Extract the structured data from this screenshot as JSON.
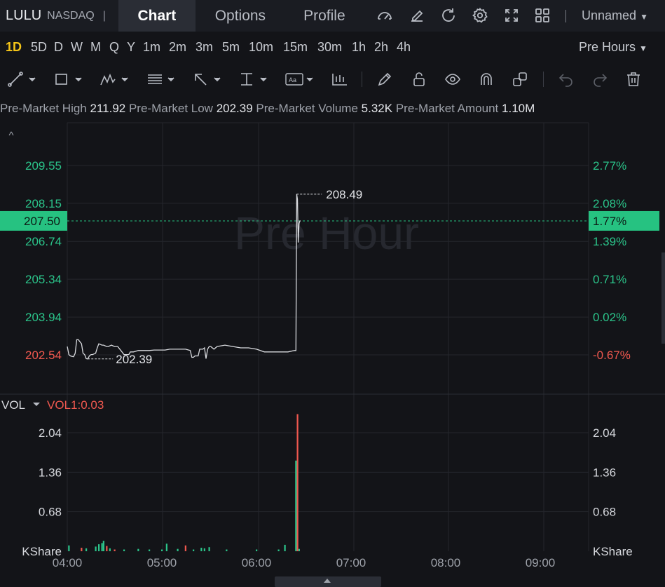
{
  "header": {
    "symbol": "LULU",
    "exchange": "NASDAQ",
    "separator": "|",
    "tabs": [
      {
        "label": "Chart",
        "active": true
      },
      {
        "label": "Options",
        "active": false
      },
      {
        "label": "Profile",
        "active": false
      }
    ],
    "icons": [
      "gauge-icon",
      "edit-icon",
      "refresh-icon",
      "gear-icon",
      "fullscreen-icon",
      "grid-icon"
    ],
    "layout_name": "Unnamed"
  },
  "intervals": {
    "items": [
      "1D",
      "5D",
      "D",
      "W",
      "M",
      "Q",
      "Y",
      "1m",
      "2m",
      "3m",
      "5m",
      "10m",
      "15m",
      "30m",
      "1h",
      "2h",
      "4h"
    ],
    "active": "1D",
    "session": "Pre Hours"
  },
  "toolbar": {
    "tools": [
      "trend-line-icon",
      "rectangle-icon",
      "pattern-icon",
      "fib-icon",
      "arrow-icon",
      "measure-icon",
      "text-icon",
      "indicator-icon",
      "pencil-icon",
      "lock-icon",
      "eye-icon",
      "magnet-icon",
      "layers-icon",
      "undo-icon",
      "redo-icon",
      "trash-icon"
    ]
  },
  "info": {
    "high_label": "Pre-Market High",
    "high": "211.92",
    "low_label": "Pre-Market Low",
    "low": "202.39",
    "volume_label": "Pre-Market Volume",
    "volume": "5.32K",
    "amount_label": "Pre-Market Amount",
    "amount": "1.10M"
  },
  "colors": {
    "up": "#2bc48a",
    "down": "#f0584f",
    "current_bg": "#26c281",
    "line": "#d8dade"
  },
  "chart_data": {
    "type": "line",
    "watermark": "Pre Hour",
    "collapse_glyph": "^",
    "price_axis_left": [
      "209.55",
      "208.15",
      "206.74",
      "205.34",
      "203.94",
      "202.54"
    ],
    "price_axis_right": [
      "2.77%",
      "2.08%",
      "1.39%",
      "0.71%",
      "0.02%",
      "-0.67%"
    ],
    "price_ticks": [
      209.55,
      208.15,
      206.74,
      205.34,
      203.94,
      202.54
    ],
    "current_price": "207.50",
    "current_pct": "1.77%",
    "current_value": 207.5,
    "max_label": "208.49",
    "max_value": 208.49,
    "min_label": "202.39",
    "min_value": 202.39,
    "x_ticks": [
      "04:00",
      "05:00",
      "06:00",
      "07:00",
      "08:00",
      "09:00"
    ],
    "x_values": [
      240,
      300,
      360,
      420,
      480,
      540
    ],
    "series": [
      {
        "x": [
          240,
          241,
          242,
          243,
          244,
          245,
          246,
          247,
          249,
          250,
          251,
          252,
          253,
          254,
          255,
          256,
          258,
          259,
          260,
          262,
          263,
          265,
          266,
          268,
          270,
          272,
          274,
          276,
          278,
          279,
          280,
          282,
          285,
          288,
          290,
          292,
          295,
          296,
          297,
          298,
          300,
          302,
          305,
          310,
          315,
          318,
          319,
          320,
          321,
          322,
          323,
          324,
          326,
          327,
          328,
          329,
          330,
          331,
          333,
          335,
          340,
          345,
          350,
          355,
          360,
          365,
          370,
          375,
          380,
          384,
          385,
          385.5,
          386,
          386.5,
          387,
          387.5,
          388
        ],
        "y": [
          202.85,
          202.55,
          202.5,
          202.48,
          202.47,
          202.6,
          203.1,
          203.1,
          202.95,
          202.6,
          202.55,
          202.4,
          202.39,
          202.5,
          202.55,
          202.55,
          202.6,
          202.8,
          202.95,
          202.9,
          202.9,
          202.85,
          202.85,
          202.9,
          202.85,
          202.85,
          202.7,
          202.55,
          202.55,
          202.55,
          202.65,
          202.65,
          202.7,
          202.7,
          202.7,
          202.7,
          202.72,
          202.72,
          202.72,
          202.72,
          202.72,
          202.72,
          202.75,
          202.75,
          202.75,
          202.7,
          202.45,
          202.45,
          202.5,
          202.5,
          202.5,
          202.75,
          202.75,
          202.8,
          202.4,
          202.75,
          202.85,
          202.85,
          202.75,
          202.85,
          202.9,
          202.85,
          202.8,
          202.8,
          202.75,
          202.65,
          202.65,
          202.65,
          202.65,
          202.7,
          202.7,
          208.49,
          208.3,
          206.7,
          207.4,
          207.5,
          207.5
        ]
      }
    ],
    "volume": {
      "label": "VOL",
      "indicator_label": "VOL1:0.03",
      "unit": "KShare",
      "axis_labels": [
        "2.04",
        "1.36",
        "0.68"
      ],
      "axis_values": [
        2.04,
        1.36,
        0.68
      ],
      "bars": [
        {
          "x": 241,
          "v": 0.1,
          "up": true
        },
        {
          "x": 249,
          "v": 0.06,
          "up": false
        },
        {
          "x": 252,
          "v": 0.05,
          "up": true
        },
        {
          "x": 258,
          "v": 0.08,
          "up": true
        },
        {
          "x": 260,
          "v": 0.12,
          "up": true
        },
        {
          "x": 262,
          "v": 0.14,
          "up": true
        },
        {
          "x": 263,
          "v": 0.18,
          "up": true
        },
        {
          "x": 265,
          "v": 0.09,
          "up": false
        },
        {
          "x": 267,
          "v": 0.05,
          "up": true
        },
        {
          "x": 270,
          "v": 0.03,
          "up": false
        },
        {
          "x": 276,
          "v": 0.03,
          "up": true
        },
        {
          "x": 285,
          "v": 0.04,
          "up": true
        },
        {
          "x": 292,
          "v": 0.03,
          "up": true
        },
        {
          "x": 300,
          "v": 0.03,
          "up": true
        },
        {
          "x": 303,
          "v": 0.13,
          "up": true
        },
        {
          "x": 310,
          "v": 0.04,
          "up": true
        },
        {
          "x": 315,
          "v": 0.1,
          "up": false
        },
        {
          "x": 320,
          "v": 0.03,
          "up": true
        },
        {
          "x": 325,
          "v": 0.06,
          "up": true
        },
        {
          "x": 327,
          "v": 0.05,
          "up": true
        },
        {
          "x": 330,
          "v": 0.07,
          "up": true
        },
        {
          "x": 341,
          "v": 0.03,
          "up": true
        },
        {
          "x": 360,
          "v": 0.03,
          "up": true
        },
        {
          "x": 374,
          "v": 0.03,
          "up": true
        },
        {
          "x": 378,
          "v": 0.11,
          "up": true
        },
        {
          "x": 385,
          "v": 1.56,
          "up": true
        },
        {
          "x": 386,
          "v": 2.36,
          "up": false
        },
        {
          "x": 387,
          "v": 0.04,
          "up": true
        }
      ]
    }
  }
}
